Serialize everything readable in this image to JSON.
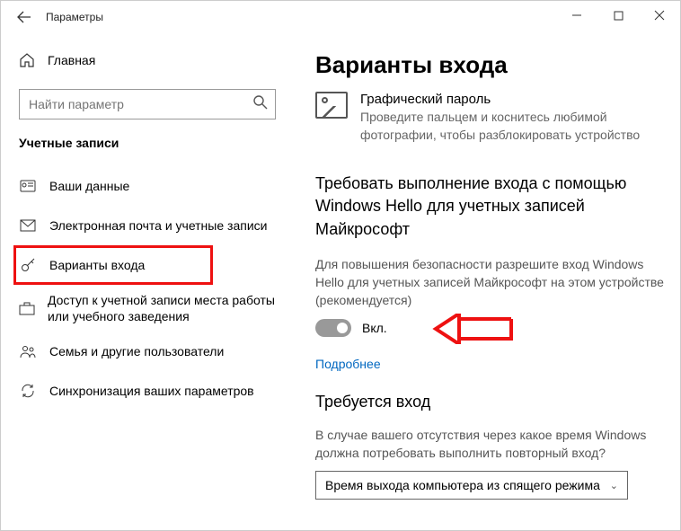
{
  "window": {
    "title": "Параметры"
  },
  "sidebar": {
    "home": "Главная",
    "search_placeholder": "Найти параметр",
    "section": "Учетные записи",
    "items": [
      {
        "label": "Ваши данные"
      },
      {
        "label": "Электронная почта и учетные записи"
      },
      {
        "label": "Варианты входа"
      },
      {
        "label": "Доступ к учетной записи места работы или учебного заведения"
      },
      {
        "label": "Семья и другие пользователи"
      },
      {
        "label": "Синхронизация ваших параметров"
      }
    ]
  },
  "content": {
    "heading": "Варианты входа",
    "picture_password": {
      "title": "Графический пароль",
      "desc": "Проведите пальцем и коснитесь любимой фотографии, чтобы разблокировать устройство"
    },
    "hello_section": {
      "heading": "Требовать выполнение входа с помощью Windows Hello для учетных записей Майкрософт",
      "desc": "Для повышения безопасности разрешите вход Windows Hello для учетных записей Майкрософт на этом устройстве (рекомендуется)",
      "toggle_label": "Вкл.",
      "toggle_on": true,
      "learn_more": "Подробнее"
    },
    "require_signin": {
      "heading": "Требуется вход",
      "question": "В случае вашего отсутствия через какое время Windows должна потребовать выполнить повторный вход?",
      "select_value": "Время выхода компьютера из спящего режима"
    }
  }
}
